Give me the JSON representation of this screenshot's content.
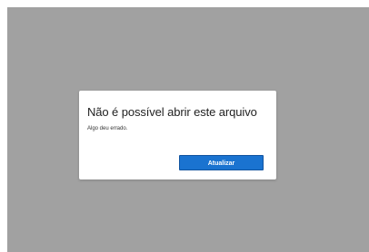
{
  "dialog": {
    "title": "Não é possível abrir este arquivo",
    "message": "Algo deu errado.",
    "refresh_label": "Atualizar"
  },
  "colors": {
    "backdrop": "#a1a1a1",
    "dialog_background": "#ffffff",
    "button_accent": "#1a73d0"
  }
}
